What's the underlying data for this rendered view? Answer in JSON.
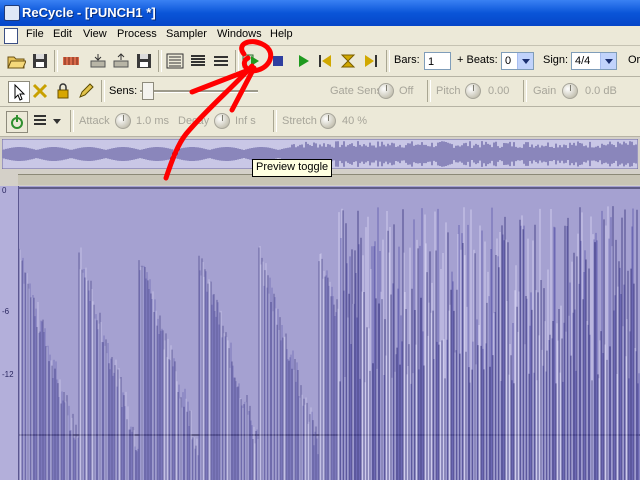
{
  "window": {
    "title": "ReCycle - [PUNCH1 *]"
  },
  "menu": [
    "File",
    "Edit",
    "View",
    "Process",
    "Sampler",
    "Windows",
    "Help"
  ],
  "toolbar1": {
    "bars_label": "Bars:",
    "bars_value": "1",
    "beats_label": "+ Beats:",
    "beats_value": "0",
    "sign_label": "Sign:",
    "sign_value": "4/4",
    "or_label": "Or"
  },
  "tooltip": "Preview toggle",
  "toolbar2": {
    "sens_label": "Sens:",
    "gate_sens_label": "Gate Sens",
    "gate_sens_value": "Off",
    "pitch_label": "Pitch",
    "pitch_value": "0.00",
    "gain_label": "Gain",
    "gain_value": "0.0 dB"
  },
  "toolbar3": {
    "attack_label": "Attack",
    "attack_value": "1.0 ms",
    "decay_label": "Decay",
    "decay_value": "Inf s",
    "stretch_label": "Stretch",
    "stretch_value": "40 %"
  },
  "db_scale": [
    "0",
    "-6",
    "-12"
  ],
  "colors": {
    "waveform_bg": "#a5a1d1",
    "waveform": "#3e3a86",
    "annotation": "#ff0000",
    "titlebar": "#0a55d8"
  }
}
